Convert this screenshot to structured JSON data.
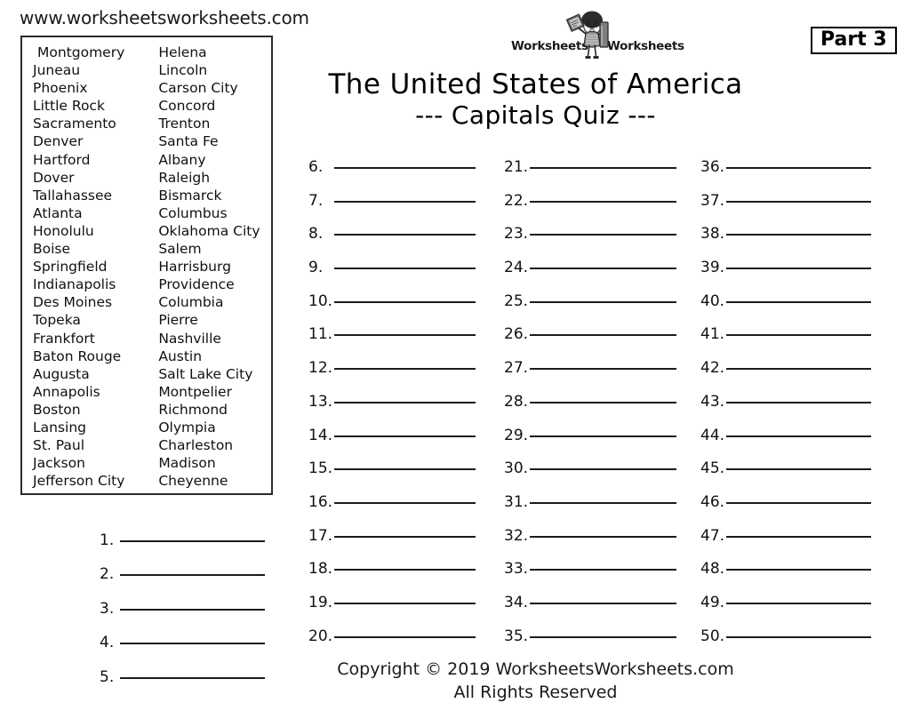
{
  "site_url": "www.worksheetsworksheets.com",
  "part_badge": "Part 3",
  "logo": {
    "word_left": "Worksheets",
    "word_right": "Worksheets",
    "icon": "student-with-books-icon"
  },
  "title": {
    "main": "The United States of America",
    "sub": "--- Capitals Quiz ---"
  },
  "word_bank": {
    "column_1": [
      "Montgomery",
      "Juneau",
      "Phoenix",
      "Little Rock",
      "Sacramento",
      "Denver",
      "Hartford",
      "Dover",
      "Tallahassee",
      "Atlanta",
      "Honolulu",
      "Boise",
      "Springfield",
      "Indianapolis",
      "Des Moines",
      "Topeka",
      "Frankfort",
      "Baton Rouge",
      "Augusta",
      "Annapolis",
      "Boston",
      "Lansing",
      "St. Paul",
      "Jackson",
      "Jefferson City"
    ],
    "column_2": [
      "Helena",
      "Lincoln",
      "Carson City",
      "Concord",
      "Trenton",
      "Santa Fe",
      "Albany",
      "Raleigh",
      "Bismarck",
      "Columbus",
      "Oklahoma City",
      "Salem",
      "Harrisburg",
      "Providence",
      "Columbia",
      "Pierre",
      "Nashville",
      "Austin",
      "Salt Lake City",
      "Montpelier",
      "Richmond",
      "Olympia",
      "Charleston",
      "Madison",
      "Cheyenne"
    ]
  },
  "answers": {
    "column_first": [
      "1.",
      "2.",
      "3.",
      "4.",
      "5."
    ],
    "column_a": [
      "6.",
      "7.",
      "8.",
      "9.",
      "10.",
      "11.",
      "12.",
      "13.",
      "14.",
      "15.",
      "16.",
      "17.",
      "18.",
      "19.",
      "20."
    ],
    "column_b": [
      "21.",
      "22.",
      "23.",
      "24.",
      "25.",
      "26.",
      "27.",
      "28.",
      "29.",
      "30.",
      "31.",
      "32.",
      "33.",
      "34.",
      "35."
    ],
    "column_c": [
      "36.",
      "37.",
      "38.",
      "39.",
      "40.",
      "41.",
      "42.",
      "43.",
      "44.",
      "45.",
      "46.",
      "47.",
      "48.",
      "49.",
      "50."
    ]
  },
  "footer": {
    "line1": "Copyright © 2019  WorksheetsWorksheets.com",
    "line2": "All Rights Reserved"
  },
  "colors": {
    "ink": "#111111",
    "rule": "#1c1c1c",
    "border": "#2b2b2b",
    "paper": "#ffffff"
  }
}
